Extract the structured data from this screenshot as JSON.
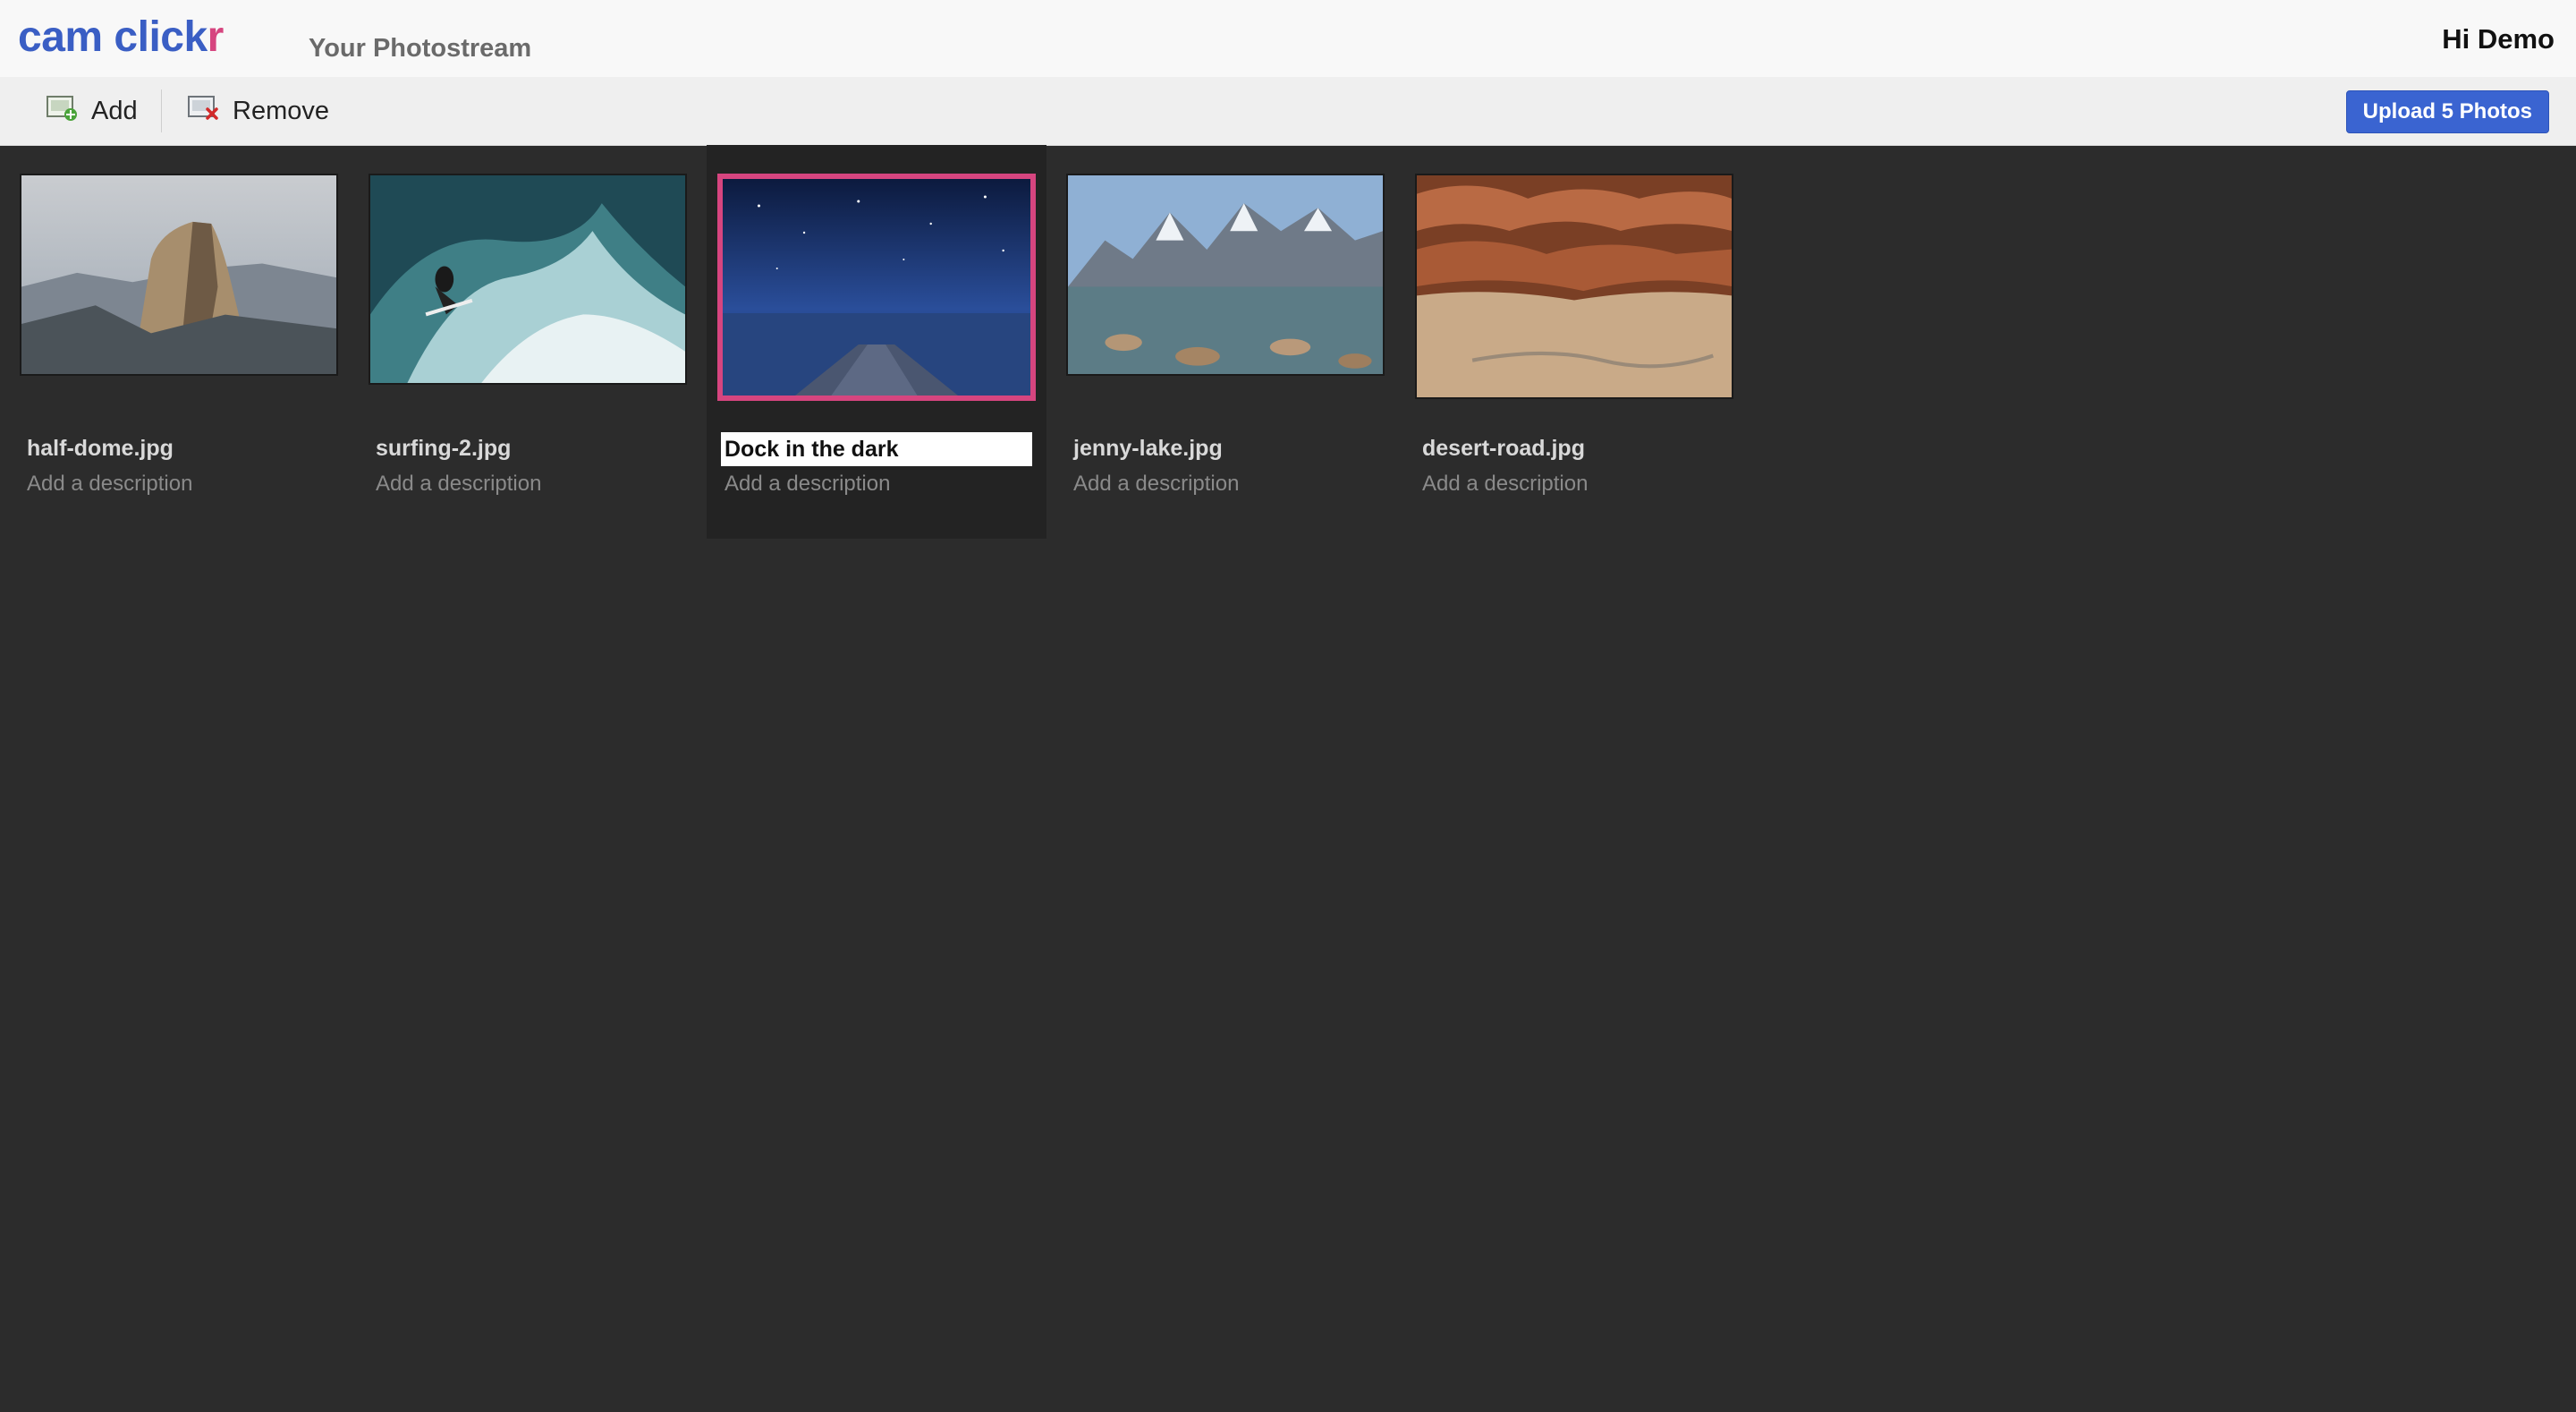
{
  "app": {
    "logo_main": "cam click",
    "logo_accent": "r",
    "page_title": "Your Photostream",
    "greeting": "Hi Demo",
    "accent_color": "#3a5ec4",
    "highlight_color": "#d6457f"
  },
  "toolbar": {
    "add_label": "Add",
    "add_icon": "add-image-icon",
    "remove_label": "Remove",
    "remove_icon": "remove-image-icon",
    "upload_label": "Upload 5 Photos"
  },
  "photos": [
    {
      "filename": "half-dome.jpg",
      "description_placeholder": "Add a description",
      "subject": "mountain"
    },
    {
      "filename": "surfing-2.jpg",
      "description_placeholder": "Add a description",
      "subject": "surfer-wave"
    },
    {
      "title_value": "Dock in the dark",
      "description_placeholder": "Add a description",
      "subject": "dock-night",
      "selected": true
    },
    {
      "filename": "jenny-lake.jpg",
      "description_placeholder": "Add a description",
      "subject": "lake-mountains"
    },
    {
      "filename": "desert-road.jpg",
      "description_placeholder": "Add a description",
      "subject": "desert"
    }
  ]
}
